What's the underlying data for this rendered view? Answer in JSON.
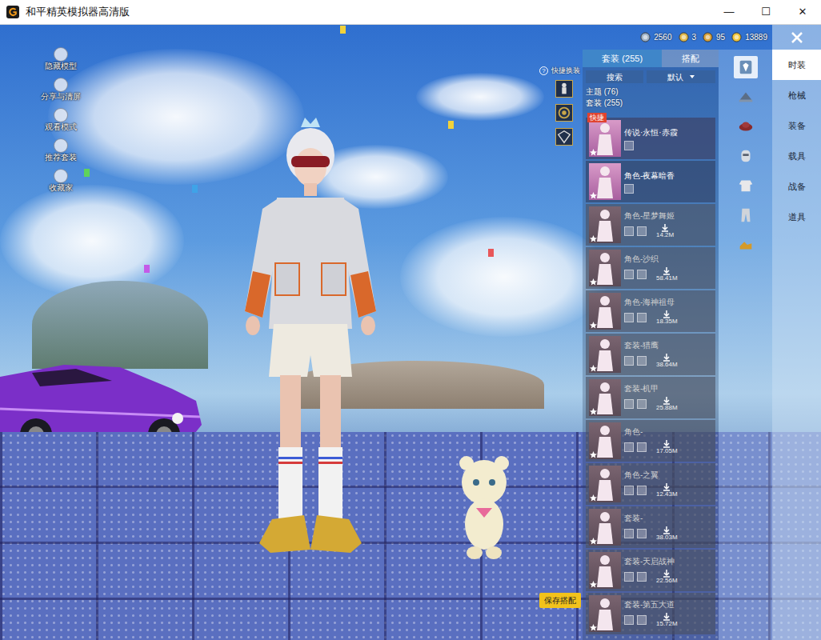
{
  "window": {
    "title": "和平精英模拟器高清版",
    "controls": [
      "—",
      "☐",
      "✕"
    ]
  },
  "left_tools": [
    {
      "label": "隐藏模型"
    },
    {
      "label": "分享与清屏"
    },
    {
      "label": "观看模式"
    },
    {
      "label": "推荐套装"
    },
    {
      "label": "收藏家"
    }
  ],
  "currencies": [
    {
      "amount": "2560"
    },
    {
      "amount": "3"
    },
    {
      "amount": "95"
    },
    {
      "amount": "13889"
    }
  ],
  "quick_swap": {
    "help": "?",
    "label": "快捷换装",
    "slots": [
      {
        "filled": true
      },
      {
        "filled": true
      },
      {
        "filled": true
      }
    ]
  },
  "save_button": "保存搭配",
  "panel": {
    "tabs": [
      {
        "label": "套装 (255)",
        "selected": true
      },
      {
        "label": "搭配",
        "selected": false
      }
    ],
    "search_button": "搜索",
    "sort": "默认",
    "groups": [
      "主题 (76)",
      "套装 (255)"
    ],
    "items": [
      {
        "name": "传说·永恒·赤霞",
        "badge": "快捷",
        "size": null,
        "downloaded": true,
        "selected": true
      },
      {
        "name": "角色-夜幕暗香",
        "badge": null,
        "size": null,
        "downloaded": true,
        "selected": false
      },
      {
        "name": "角色-星梦舞姬",
        "badge": null,
        "size": "14.2M",
        "downloaded": false,
        "selected": false
      },
      {
        "name": "角色-沙织",
        "badge": null,
        "size": "58.41M",
        "downloaded": false,
        "selected": false
      },
      {
        "name": "角色-海神祖母",
        "badge": null,
        "size": "18.35M",
        "downloaded": false,
        "selected": false
      },
      {
        "name": "套装-猎鹰",
        "badge": null,
        "size": "38.64M",
        "downloaded": false,
        "selected": false
      },
      {
        "name": "套装-机甲",
        "badge": null,
        "size": "25.88M",
        "downloaded": false,
        "selected": false
      },
      {
        "name": "角色-",
        "badge": null,
        "size": "17.05M",
        "downloaded": false,
        "selected": false
      },
      {
        "name": "角色-之翼",
        "badge": null,
        "size": "12.43M",
        "downloaded": false,
        "selected": false
      },
      {
        "name": "套装-",
        "badge": null,
        "size": "38.03M",
        "downloaded": false,
        "selected": false
      },
      {
        "name": "套装-天启战神",
        "badge": null,
        "size": "22.56M",
        "downloaded": false,
        "selected": false
      },
      {
        "name": "套装-第五大道",
        "badge": null,
        "size": "15.72M",
        "downloaded": false,
        "selected": false
      }
    ]
  },
  "subcategory_icons": [
    {
      "selected": true
    },
    {
      "selected": false
    },
    {
      "selected": false
    },
    {
      "selected": false
    },
    {
      "selected": false
    },
    {
      "selected": false
    },
    {
      "selected": false
    }
  ],
  "category_tabs": [
    {
      "label": "时装",
      "selected": true
    },
    {
      "label": "枪械",
      "selected": false
    },
    {
      "label": "装备",
      "selected": false
    },
    {
      "label": "载具",
      "selected": false
    },
    {
      "label": "战备",
      "selected": false
    },
    {
      "label": "道具",
      "selected": false
    }
  ]
}
